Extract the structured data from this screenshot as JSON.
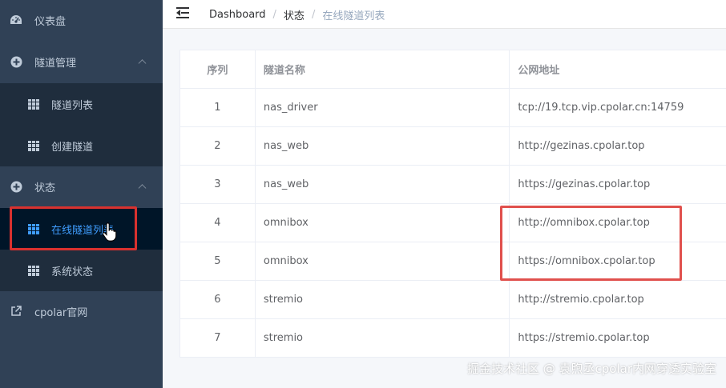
{
  "sidebar": {
    "items": [
      {
        "label": "仪表盘",
        "icon": "dashboard-icon"
      },
      {
        "label": "隧道管理",
        "icon": "circle-plus-icon",
        "expanded": true
      },
      {
        "label": "隧道列表",
        "icon": "grid-icon"
      },
      {
        "label": "创建隧道",
        "icon": "grid-icon"
      },
      {
        "label": "状态",
        "icon": "circle-plus-icon",
        "expanded": true
      },
      {
        "label": "在线隧道列表",
        "icon": "grid-icon",
        "active": true
      },
      {
        "label": "系统状态",
        "icon": "grid-icon"
      },
      {
        "label": "cpolar官网",
        "icon": "external-link-icon"
      }
    ]
  },
  "header": {
    "breadcrumb": [
      "Dashboard",
      "状态",
      "在线隧道列表"
    ]
  },
  "table": {
    "columns": [
      "序列",
      "隧道名称",
      "公网地址"
    ],
    "rows": [
      [
        "1",
        "nas_driver",
        "tcp://19.tcp.vip.cpolar.cn:14759"
      ],
      [
        "2",
        "nas_web",
        "http://gezinas.cpolar.top"
      ],
      [
        "3",
        "nas_web",
        "https://gezinas.cpolar.top"
      ],
      [
        "4",
        "omnibox",
        "http://omnibox.cpolar.top"
      ],
      [
        "5",
        "omnibox",
        "https://omnibox.cpolar.top"
      ],
      [
        "6",
        "stremio",
        "http://stremio.cpolar.top"
      ],
      [
        "7",
        "stremio",
        "https://stremio.cpolar.top"
      ]
    ]
  },
  "watermark": "掘金技术社区 @ 袁煦丞cpolar内网穿透实验室",
  "colors": {
    "sidebar_bg": "#304156",
    "submenu_bg": "#1f2d3d",
    "active": "#409eff",
    "highlight": "#d9312f"
  }
}
